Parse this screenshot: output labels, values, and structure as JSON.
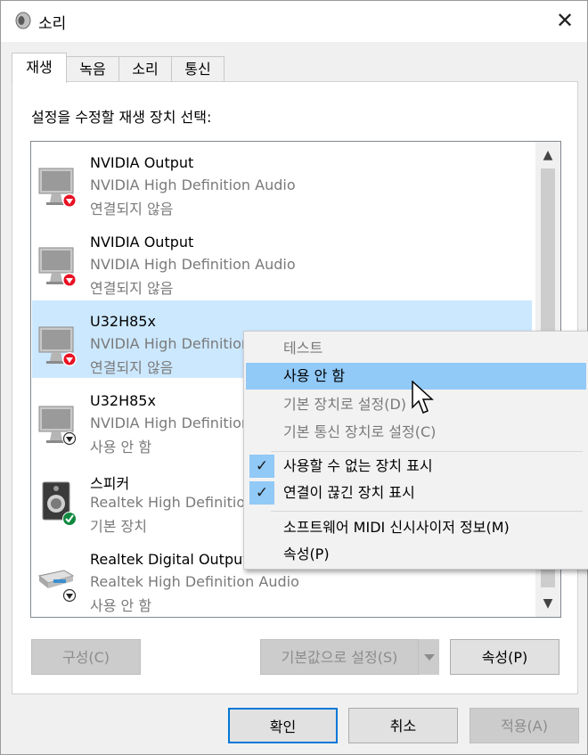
{
  "window": {
    "title": "소리",
    "close_glyph": "✕"
  },
  "tabs": [
    {
      "label": "재생",
      "active": true
    },
    {
      "label": "녹음",
      "active": false
    },
    {
      "label": "소리",
      "active": false
    },
    {
      "label": "통신",
      "active": false
    }
  ],
  "prompt": "설정을 수정할 재생 장치 선택:",
  "devices": [
    {
      "name": "NVIDIA Output",
      "desc": "NVIDIA High Definition Audio",
      "status": "연결되지 않음",
      "icon": "monitor-icon",
      "badge": "red-down-arrow"
    },
    {
      "name": "NVIDIA Output",
      "desc": "NVIDIA High Definition Audio",
      "status": "연결되지 않음",
      "icon": "monitor-icon",
      "badge": "red-down-arrow"
    },
    {
      "name": "U32H85x",
      "desc": "NVIDIA High Definition Audio",
      "status": "연결되지 않음",
      "icon": "monitor-icon",
      "badge": "red-down-arrow",
      "selected": true
    },
    {
      "name": "U32H85x",
      "desc": "NVIDIA High Definition Audio",
      "status": "사용 안 함",
      "icon": "monitor-icon",
      "badge": "black-down-arrow"
    },
    {
      "name": "스피커",
      "desc": "Realtek High Definition Audio",
      "status": "기본 장치",
      "icon": "speaker-icon",
      "badge": "green-check"
    },
    {
      "name": "Realtek Digital Output",
      "desc": "Realtek High Definition Audio",
      "status": "사용 안 함",
      "icon": "digital-output-icon",
      "badge": "black-down-arrow"
    }
  ],
  "context_menu": [
    {
      "label": "테스트",
      "disabled": true
    },
    {
      "label": "사용 안 함",
      "highlighted": true
    },
    {
      "label": "기본 장치로 설정(D)",
      "disabled": true
    },
    {
      "label": "기본 통신 장치로 설정(C)",
      "disabled": true
    },
    {
      "label": "사용할 수 없는 장치 표시",
      "checked": true
    },
    {
      "label": "연결이 끊긴 장치 표시",
      "checked": true
    },
    {
      "label": "소프트웨어 MIDI 신시사이저 정보(M)"
    },
    {
      "label": "속성(P)"
    }
  ],
  "buttons": {
    "configure": "구성(C)",
    "set_default": "기본값으로 설정(S)",
    "properties": "속성(P)",
    "ok": "확인",
    "cancel": "취소",
    "apply": "적용(A)"
  },
  "scroll": {
    "up_glyph": "▲",
    "down_glyph": "▼"
  },
  "colors": {
    "selection": "#cce8ff",
    "menu_highlight": "#91c9f7",
    "accent": "#0078d7",
    "error_badge": "#e81123",
    "ok_badge": "#10893e"
  }
}
